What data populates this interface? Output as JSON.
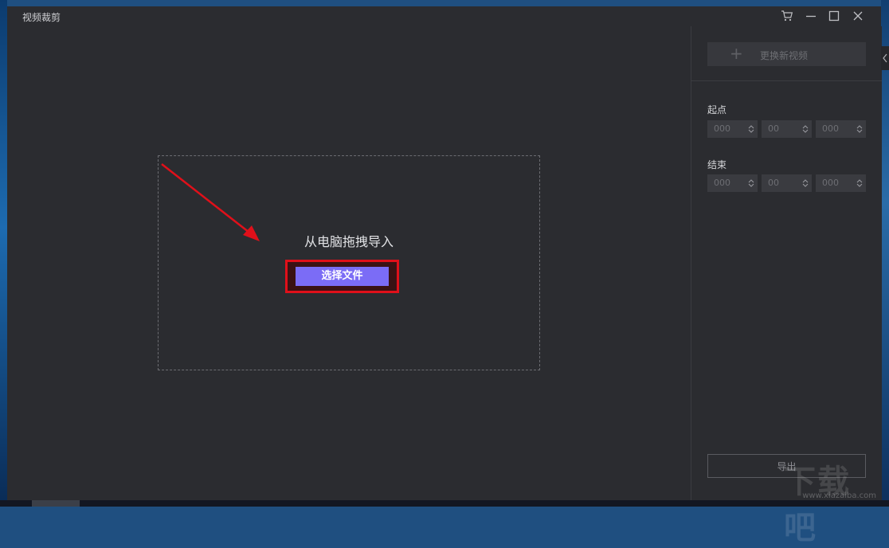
{
  "window": {
    "title": "视频裁剪"
  },
  "titlebar_icons": [
    "cart-icon",
    "minimize-icon",
    "maximize-icon",
    "close-icon"
  ],
  "dropzone": {
    "label": "从电脑拖拽导入",
    "choose_button": "选择文件"
  },
  "panel": {
    "replace_button": "更换新视频",
    "start": {
      "label": "起点",
      "fields": [
        {
          "value": "000",
          "placeholder": "000"
        },
        {
          "value": "00",
          "placeholder": "00"
        },
        {
          "value": "000",
          "placeholder": "000"
        }
      ]
    },
    "end": {
      "label": "结束",
      "fields": [
        {
          "value": "000",
          "placeholder": "000"
        },
        {
          "value": "00",
          "placeholder": "00"
        },
        {
          "value": "000",
          "placeholder": "000"
        }
      ]
    },
    "export_button": "导出"
  },
  "watermark": {
    "text": "下载吧",
    "url": "www.xiazaiba.com"
  },
  "colors": {
    "window_bg": "#2b2c30",
    "accent_button": "#7b6cf6",
    "highlight_box": "#e0101a",
    "annotation_arrow": "#e0101a"
  }
}
